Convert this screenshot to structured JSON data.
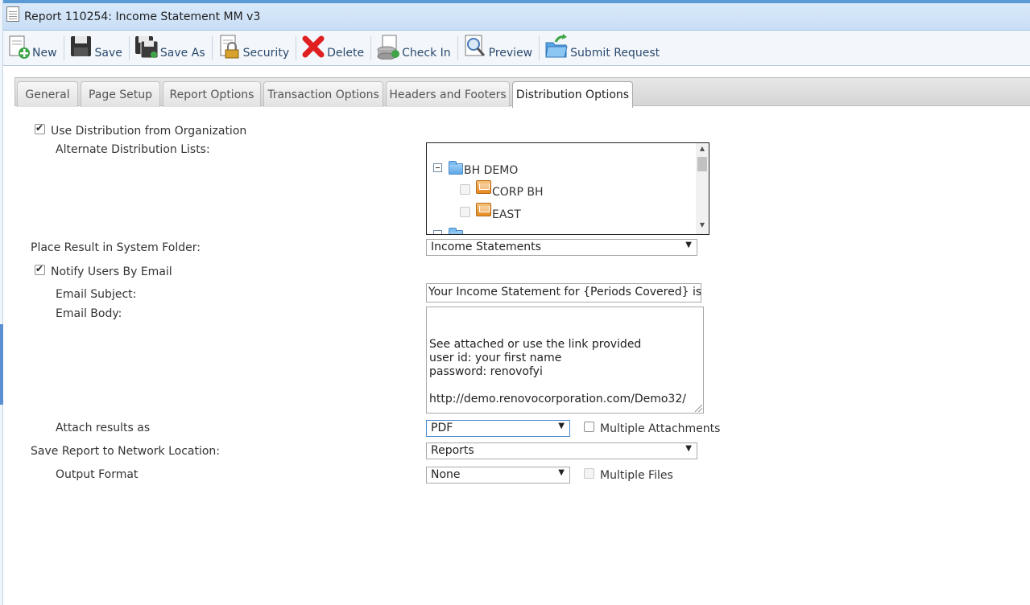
{
  "window": {
    "title": "Report 110254: Income Statement MM v3"
  },
  "toolbar": {
    "new": "New",
    "save": "Save",
    "save_as": "Save As",
    "security": "Security",
    "delete": "Delete",
    "check_in": "Check In",
    "preview": "Preview",
    "submit_request": "Submit Request"
  },
  "tabs": [
    {
      "label": "General"
    },
    {
      "label": "Page Setup"
    },
    {
      "label": "Report Options"
    },
    {
      "label": "Transaction Options"
    },
    {
      "label": "Headers and Footers"
    },
    {
      "label": "Distribution Options",
      "active": true
    }
  ],
  "form": {
    "use_distribution": {
      "label": "Use Distribution from Organization",
      "checked": true
    },
    "alternate_lists_label": "Alternate Distribution Lists:",
    "tree": {
      "root": "BH DEMO",
      "children": [
        "CORP BH",
        "EAST"
      ]
    },
    "system_folder": {
      "label": "Place Result in System Folder:",
      "value": "Income Statements"
    },
    "notify_email": {
      "label": "Notify Users By Email",
      "checked": true
    },
    "email_subject": {
      "label": "Email Subject:",
      "value": "Your Income Statement for {Periods Covered} is ready"
    },
    "email_body": {
      "label": "Email Body:",
      "value": "See attached or use the link provided\nuser id: your first name\npassword: renovofyi\n\nhttp://demo.renovocorporation.com/Demo32/"
    },
    "attach_as": {
      "label": "Attach results as",
      "value": "PDF"
    },
    "multiple_attachments": {
      "label": "Multiple Attachments",
      "checked": false
    },
    "network_location": {
      "label": "Save Report to Network Location:",
      "value": "Reports"
    },
    "output_format": {
      "label": "Output Format",
      "value": "None"
    },
    "multiple_files": {
      "label": "Multiple Files",
      "checked": false,
      "disabled": true
    }
  }
}
